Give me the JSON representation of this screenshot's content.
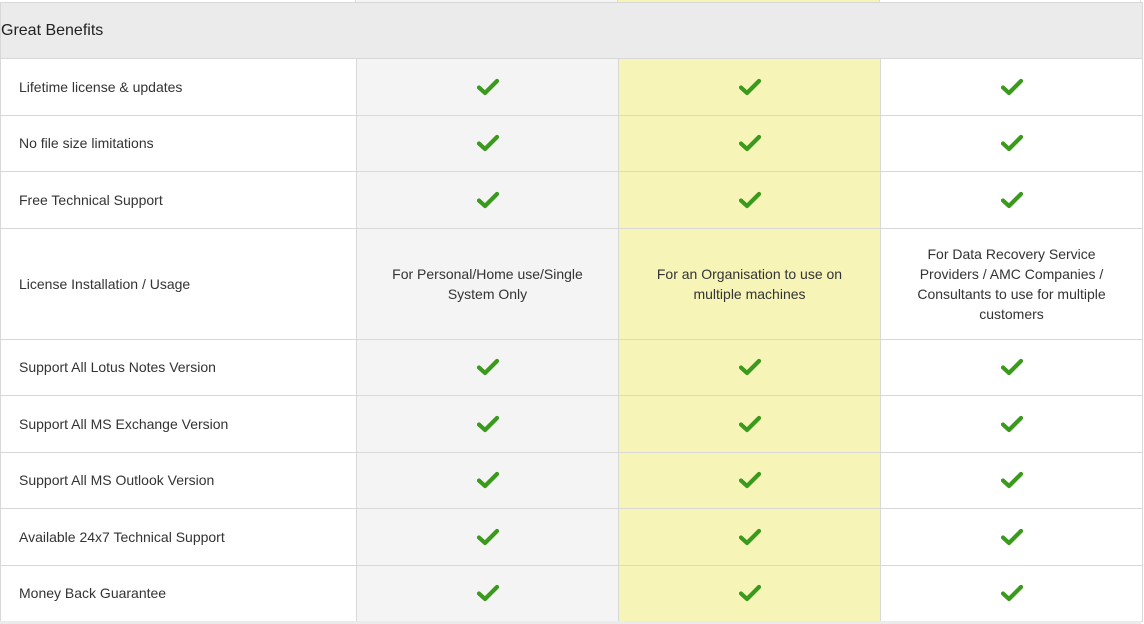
{
  "section": {
    "title": "Great Benefits"
  },
  "colors": {
    "check": "#3a9a1c",
    "highlight": "#f7f4b8",
    "altcol": "#f4f4f4"
  },
  "rows": [
    {
      "feature": "Lifetime license & updates",
      "type": "check"
    },
    {
      "feature": "No file size limitations",
      "type": "check"
    },
    {
      "feature": "Free Technical Support",
      "type": "check"
    },
    {
      "feature": "License Installation / Usage",
      "type": "text",
      "values": [
        "For Personal/Home use/Single System Only",
        "For an Organisation to use on multiple machines",
        "For Data Recovery Service Providers / AMC Companies / Consultants to use for multiple customers"
      ]
    },
    {
      "feature": "Support All Lotus Notes Version",
      "type": "check"
    },
    {
      "feature": "Support All MS Exchange Version",
      "type": "check"
    },
    {
      "feature": "Support All MS Outlook Version",
      "type": "check"
    },
    {
      "feature": "Available 24x7 Technical Support",
      "type": "check"
    },
    {
      "feature": "Money Back Guarantee",
      "type": "check"
    }
  ],
  "icons": {
    "included": "check-icon"
  }
}
